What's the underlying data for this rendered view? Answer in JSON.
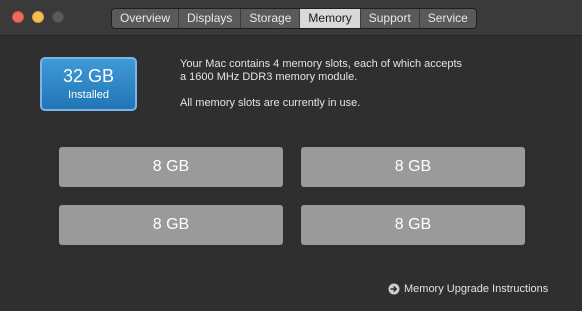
{
  "window": {
    "tabs": [
      {
        "label": "Overview"
      },
      {
        "label": "Displays"
      },
      {
        "label": "Storage"
      },
      {
        "label": "Memory"
      },
      {
        "label": "Support"
      },
      {
        "label": "Service"
      }
    ],
    "active_tab": "Memory"
  },
  "memory": {
    "total": "32 GB",
    "total_caption": "Installed",
    "description_line1": "Your Mac contains 4 memory slots, each of which accepts",
    "description_line2": "a 1600 MHz DDR3 memory module.",
    "status": "All memory slots are currently in use.",
    "slots": [
      {
        "label": "8 GB"
      },
      {
        "label": "8 GB"
      },
      {
        "label": "8 GB"
      },
      {
        "label": "8 GB"
      }
    ],
    "upgrade_link": "Memory Upgrade Instructions"
  },
  "icons": {
    "close": "close-icon",
    "minimize": "minimize-icon",
    "fullscreen": "fullscreen-icon",
    "upgrade": "arrow-circle-right-icon"
  },
  "colors": {
    "badge": "#2b86c6",
    "slot": "#9a9a9a",
    "background": "#2f2f2f",
    "close": "#ed6a5e",
    "minimize": "#f5bf4f"
  }
}
